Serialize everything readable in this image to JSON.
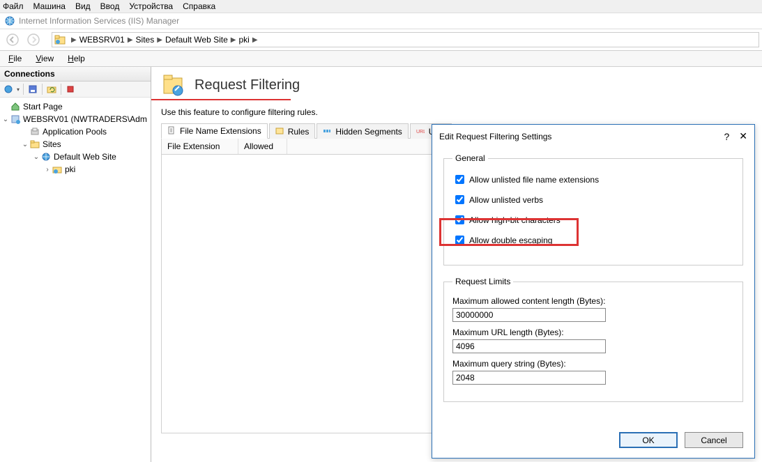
{
  "topmenu": {
    "file": "Файл",
    "machine": "Машина",
    "view": "Вид",
    "input": "Ввод",
    "devices": "Устройства",
    "help": "Справка"
  },
  "app_title": "Internet Information Services (IIS) Manager",
  "breadcrumb": {
    "server": "WEBSRV01",
    "sites": "Sites",
    "site": "Default Web Site",
    "app": "pki"
  },
  "menubar": {
    "file": "File",
    "view": "View",
    "help": "Help"
  },
  "connections": {
    "title": "Connections",
    "start_page": "Start Page",
    "server": "WEBSRV01 (NWTRADERS\\Adm",
    "app_pools": "Application Pools",
    "sites": "Sites",
    "default_site": "Default Web Site",
    "pki": "pki"
  },
  "main": {
    "heading": "Request Filtering",
    "desc": "Use this feature to configure filtering rules.",
    "tabs": {
      "ext": "File Name Extensions",
      "rules": "Rules",
      "hidden": "Hidden Segments",
      "url": "URL"
    },
    "cols": {
      "ext": "File Extension",
      "allowed": "Allowed"
    }
  },
  "dialog": {
    "title": "Edit Request Filtering Settings",
    "general": "General",
    "chk_ext": "Allow unlisted file name extensions",
    "chk_verbs": "Allow unlisted verbs",
    "chk_highbit": "Allow high-bit characters",
    "chk_escape": "Allow double escaping",
    "limits": "Request Limits",
    "lbl_content": "Maximum allowed content length (Bytes):",
    "val_content": "30000000",
    "lbl_url": "Maximum URL length (Bytes):",
    "val_url": "4096",
    "lbl_query": "Maximum query string (Bytes):",
    "val_query": "2048",
    "ok": "OK",
    "cancel": "Cancel"
  }
}
